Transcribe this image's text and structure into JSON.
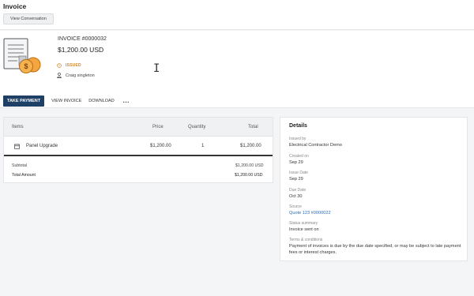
{
  "header": {
    "title": "Invoice",
    "view_conversation_label": "View Conversation"
  },
  "invoice": {
    "number": "INVOICE #0000032",
    "amount": "$1,200.00 USD",
    "status": "ISSUED",
    "status_color": "#d1862c",
    "customer": "Craig singleton"
  },
  "actions": {
    "take_payment": "TAKE PAYMENT",
    "view_invoice": "VIEW INVOICE",
    "download": "DOWNLOAD",
    "more": "...",
    "primary_color": "#1e3f66"
  },
  "items": {
    "columns": [
      "Items",
      "Price",
      "Quantity",
      "Total"
    ],
    "rows": [
      {
        "icon": "calendar-icon",
        "name": "Panel Upgrade",
        "price": "$1,200.00",
        "quantity": "1",
        "total": "$1,200.00"
      }
    ],
    "subtotal_label": "Subtotal",
    "subtotal_value": "$1,200.00 USD",
    "total_label": "Total Amount",
    "total_value": "$1,200.00 USD"
  },
  "details": {
    "title": "Details",
    "issued_by_label": "Issued by",
    "issued_by": "Electrical Contractor Demo",
    "created_on_label": "Created on",
    "created_on": "Sep 29",
    "issue_date_label": "Issue Date",
    "issue_date": "Sep 29",
    "due_date_label": "Due Date",
    "due_date": "Oct 30",
    "source_label": "Source",
    "source": "Quote 123 #0000022",
    "status_summary_label": "Status summary",
    "status_summary": "Invoice sent on",
    "terms_label": "Terms & conditions",
    "terms": "Payment of invoices is due by the due date specified, or may be subject to late payment fees or interest charges."
  }
}
